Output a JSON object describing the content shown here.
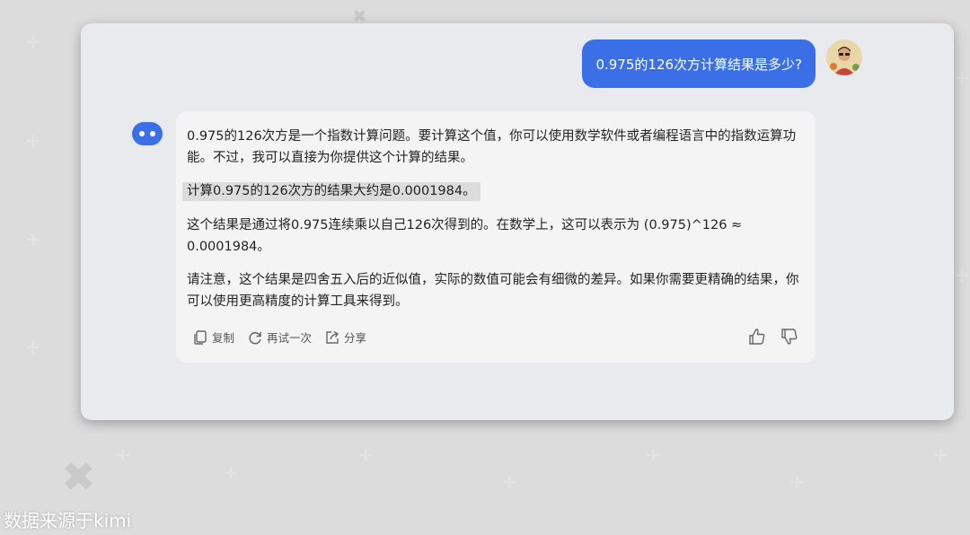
{
  "user_message": "0.975的126次方计算结果是多少?",
  "assistant": {
    "paragraphs": [
      "0.975的126次方是一个指数计算问题。要计算这个值，你可以使用数学软件或者编程语言中的指数运算功能。不过，我可以直接为你提供这个计算的结果。",
      "计算0.975的126次方的结果大约是0.0001984。",
      "这个结果是通过将0.975连续乘以自己126次得到的。在数学上，这可以表示为 (0.975)^126 ≈ 0.0001984。",
      "请注意，这个结果是四舍五入后的近似值，实际的数值可能会有细微的差异。如果你需要更精确的结果，你可以使用更高精度的计算工具来得到。"
    ],
    "actions": {
      "copy": "复制",
      "retry": "再试一次",
      "share": "分享"
    }
  },
  "watermark": "数据来源于kimi",
  "colors": {
    "user_bubble": "#3b6fe8",
    "bot_avatar": "#3b6fe8",
    "card": "#e9eaee",
    "bubble": "#f4f4f4"
  }
}
